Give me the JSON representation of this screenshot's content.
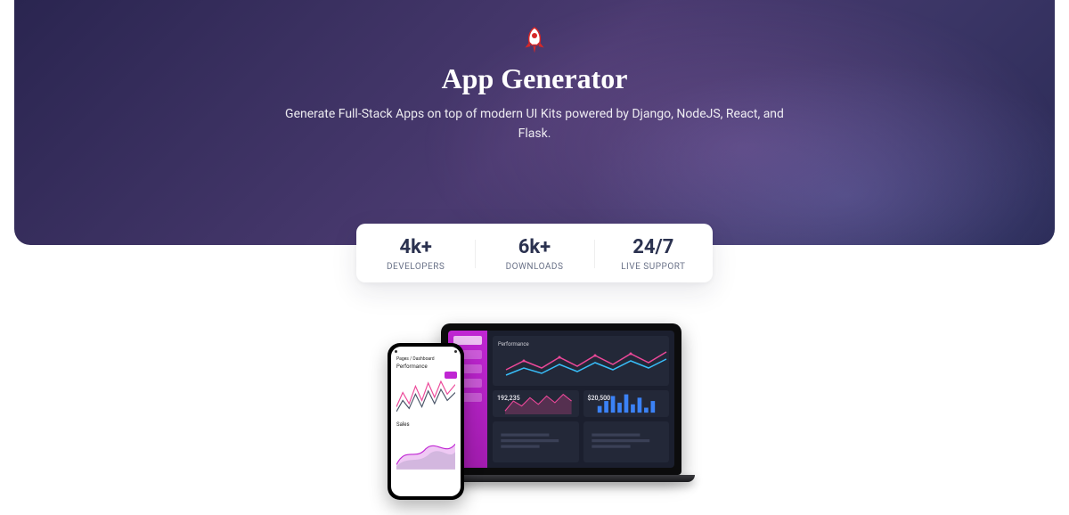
{
  "hero": {
    "title": "App Generator",
    "subtitle": "Generate Full-Stack Apps on top of modern UI Kits powered by Django, NodeJS, React, and Flask."
  },
  "stats": [
    {
      "value": "4k+",
      "label": "DEVELOPERS"
    },
    {
      "value": "6k+",
      "label": "DOWNLOADS"
    },
    {
      "value": "24/7",
      "label": "LIVE SUPPORT"
    }
  ],
  "mockup": {
    "desktop": {
      "chart_title": "Performance",
      "card1_value": "192,235",
      "card2_value": "$20,500"
    },
    "phone": {
      "header": "Pages / Dashboard",
      "chart1_title": "Performance",
      "chart2_title": "Sales"
    }
  },
  "colors": {
    "accent": "#c026d3",
    "stat_value": "#2b3250"
  }
}
